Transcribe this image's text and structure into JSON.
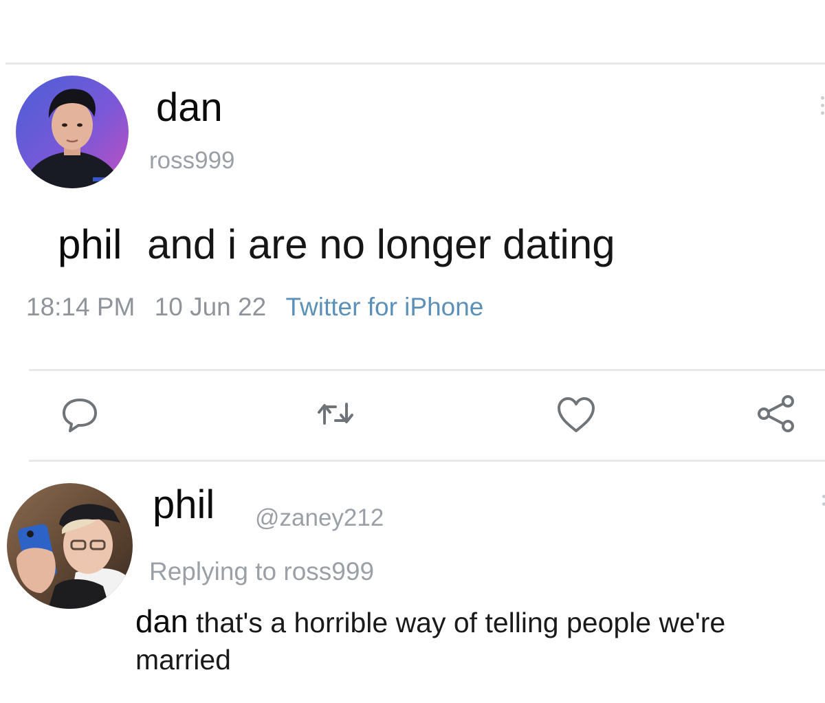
{
  "tweet": {
    "author_name": "dan",
    "author_handle": "ross999",
    "text_mention": "phil",
    "text_body": " and i are no longer dating",
    "time": "18:14 PM",
    "date": "10 Jun 22",
    "source": "Twitter for iPhone",
    "actions": {
      "reply_icon": "reply-icon",
      "retweet_icon": "retweet-icon",
      "like_icon": "heart-icon",
      "share_icon": "share-icon"
    }
  },
  "reply": {
    "author_name": "phil",
    "author_handle": "@zaney212",
    "replying_to": "Replying to ross999",
    "text_mention": "dan",
    "text_body": " that's a horrible way of telling people we're married"
  },
  "colors": {
    "muted_text": "#8e949a",
    "source_link": "#5b91b8",
    "divider": "#e6e8ea",
    "icon_stroke": "#6f7479"
  }
}
